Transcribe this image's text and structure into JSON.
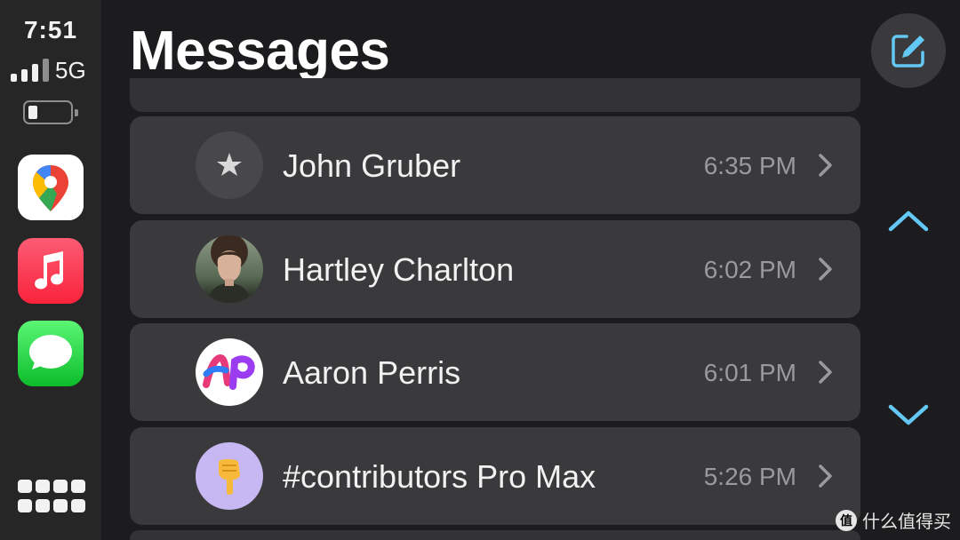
{
  "status": {
    "time": "7:51",
    "network": "5G"
  },
  "dock": {
    "apps": [
      {
        "name": "Google Maps"
      },
      {
        "name": "Music"
      },
      {
        "name": "Messages"
      }
    ]
  },
  "header": {
    "title": "Messages"
  },
  "conversations": [
    {
      "name": "John Gruber",
      "time": "6:35 PM",
      "avatar": "star-icon"
    },
    {
      "name": "Hartley Charlton",
      "time": "6:02 PM",
      "avatar": "profile-photo"
    },
    {
      "name": "Aaron Perris",
      "time": "6:01 PM",
      "avatar": "ap-logo"
    },
    {
      "name": "#contributors Pro Max",
      "time": "5:26 PM",
      "avatar": "pointing-hand-emoji"
    }
  ],
  "colors": {
    "accent": "#64c8f5",
    "row_bg": "#3a3a3c",
    "background": "#1c1c1e",
    "dock_bg": "#262626"
  },
  "watermark": {
    "text": "什么值得买",
    "icon": "值"
  }
}
